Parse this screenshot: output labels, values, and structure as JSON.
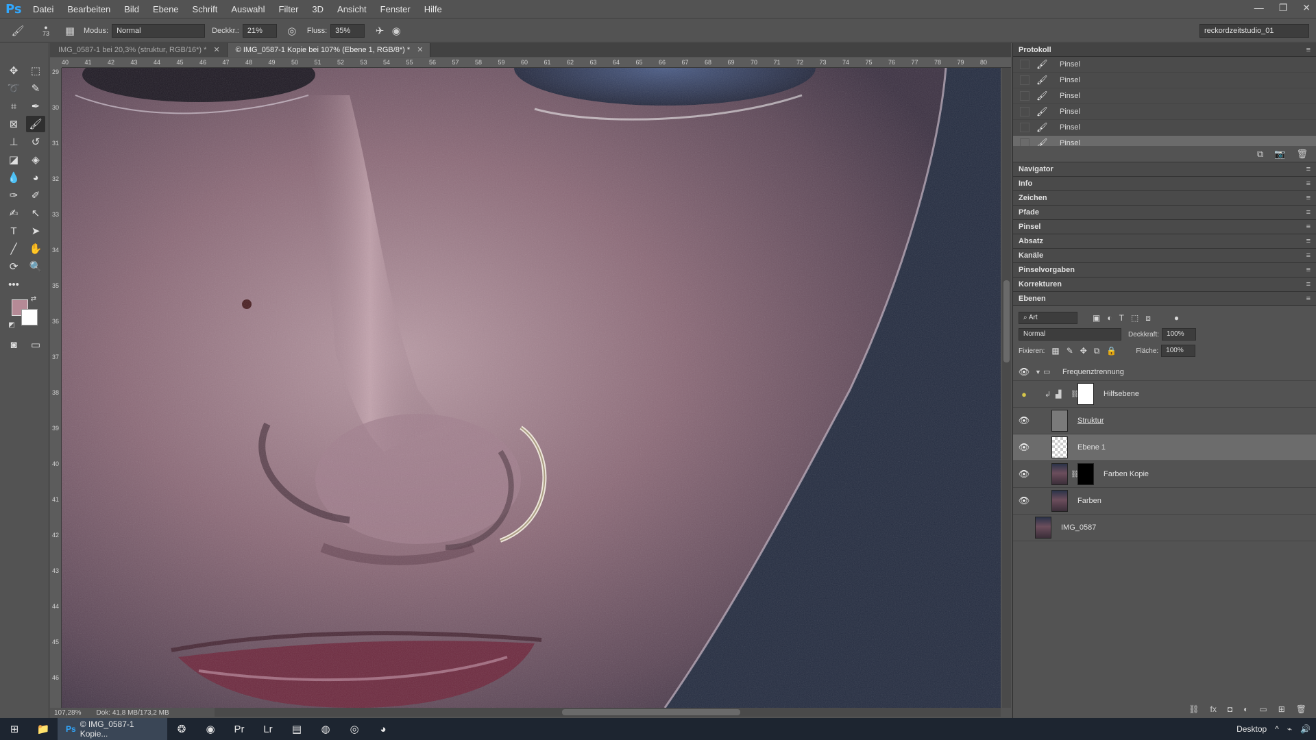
{
  "app": {
    "logo": "Ps"
  },
  "menu": [
    "Datei",
    "Bearbeiten",
    "Bild",
    "Ebene",
    "Schrift",
    "Auswahl",
    "Filter",
    "3D",
    "Ansicht",
    "Fenster",
    "Hilfe"
  ],
  "window_controls": {
    "minimize": "—",
    "restore": "❐",
    "close": "✕"
  },
  "options": {
    "brush_size": "73",
    "mode_label": "Modus:",
    "mode_value": "Normal",
    "opacity_label": "Deckkr.:",
    "opacity_value": "21%",
    "flow_label": "Fluss:",
    "flow_value": "35%",
    "workspace": "reckordzeitstudio_01"
  },
  "tabs": [
    {
      "label": "IMG_0587-1 bei 20,3% (struktur, RGB/16*) *",
      "active": false
    },
    {
      "label": "© IMG_0587-1 Kopie bei 107% (Ebene 1, RGB/8*) *",
      "active": true
    }
  ],
  "ruler_h": [
    "40",
    "41",
    "42",
    "43",
    "44",
    "45",
    "46",
    "47",
    "48",
    "49",
    "50",
    "51",
    "52",
    "53",
    "54",
    "55",
    "56",
    "57",
    "58",
    "59",
    "60",
    "61",
    "62",
    "63",
    "64",
    "65",
    "66",
    "67",
    "68",
    "69",
    "70",
    "71",
    "72",
    "73",
    "74",
    "75",
    "76",
    "77",
    "78",
    "79",
    "80"
  ],
  "ruler_v": [
    "29",
    "30",
    "31",
    "32",
    "33",
    "34",
    "35",
    "36",
    "37",
    "38",
    "39",
    "40",
    "41",
    "42",
    "43",
    "44",
    "45",
    "46"
  ],
  "status": {
    "zoom": "107,28%",
    "doc": "Dok: 41,8 MB/173,2 MB"
  },
  "history": {
    "title": "Protokoll",
    "items": [
      "Pinsel",
      "Pinsel",
      "Pinsel",
      "Pinsel",
      "Pinsel",
      "Pinsel"
    ],
    "selected_index": 5
  },
  "collapsed_panels": [
    "Navigator",
    "Info",
    "Zeichen",
    "Pfade",
    "Pinsel",
    "Absatz",
    "Kanäle",
    "Pinselvorgaben",
    "Korrekturen"
  ],
  "layers": {
    "title": "Ebenen",
    "filter": "Art",
    "blend_mode": "Normal",
    "opacity_label": "Deckkraft:",
    "opacity_value": "100%",
    "lock_label": "Fixieren:",
    "fill_label": "Fläche:",
    "fill_value": "100%",
    "group_name": "Frequenztrennung",
    "rows": [
      {
        "name": "Hilfsebene",
        "visible": true,
        "selected": false
      },
      {
        "name": "Struktur",
        "visible": true,
        "selected": false
      },
      {
        "name": "Ebene 1",
        "visible": true,
        "selected": true
      },
      {
        "name": "Farben Kopie",
        "visible": true,
        "selected": false
      },
      {
        "name": "Farben",
        "visible": true,
        "selected": false
      },
      {
        "name": "IMG_0587",
        "visible": false,
        "selected": false
      }
    ]
  },
  "taskbar": {
    "active_window": "© IMG_0587-1 Kopie...",
    "desktop": "Desktop"
  },
  "colors": {
    "foreground": "#b58a96",
    "background": "#ffffff",
    "accent": "#31a8ff"
  }
}
